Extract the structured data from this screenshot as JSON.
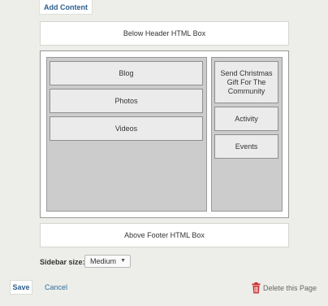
{
  "toolbar": {
    "add_content_label": "Add Content"
  },
  "boxes": {
    "below_header": "Below Header HTML Box",
    "above_footer": "Above Footer HTML Box"
  },
  "main_modules": [
    "Blog",
    "Photos",
    "Videos"
  ],
  "sidebar_modules": [
    "Send Christmas Gift For The Community",
    "Activity",
    "Events"
  ],
  "sidebar_size": {
    "label": "Sidebar size:",
    "value": "Medium"
  },
  "actions": {
    "save_label": "Save",
    "cancel_label": "Cancel",
    "delete_label": "Delete this Page"
  },
  "icons": {
    "delete": "trash-icon",
    "dropdown": "chevron-down-icon"
  },
  "colors": {
    "link": "#2f5f8f",
    "delete_icon": "#cc2a2a"
  }
}
